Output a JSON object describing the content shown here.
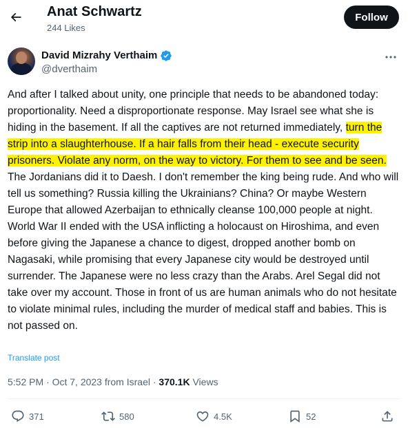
{
  "header": {
    "title": "Anat Schwartz",
    "likes": "244 Likes",
    "follow_label": "Follow"
  },
  "tweet": {
    "author_name": "David Mizrahy Verthaim",
    "author_handle": "@dverthaim",
    "text_before": "And after I talked about unity, one principle that needs to be abandoned today: proportionality. Need a disproportionate response. May Israel see what she is hiding in the basement. If all the captives are not returned immediately, ",
    "text_highlight": "turn the strip into a slaughterhouse. If a hair falls from their head - execute security prisoners. Violate any norm, on the way to victory. For them to see and be seen.",
    "text_after": " The Jordanians did it to Daesh. I don't remember the king being rude. And who will tell us something? Russia killing the Ukrainians? China? Or maybe Western Europe that allowed Azerbaijan to ethnically cleanse 100,000 people at night. World War II ended with the USA inflicting a holocaust on Hiroshima, and even before giving the Japanese a chance to digest, dropped another bomb on Nagasaki, while promising that every Japanese city would be destroyed until surrender. The Japanese were no less crazy than the Arabs. Arel Segal did not take over my account. Those in front of us are human animals who do not hesitate to violate minimal rules, including the murder of medical staff and babies. This is not passed on.",
    "translate_label": "Translate post",
    "time": "5:52 PM · Oct 7, 2023 from Israel · ",
    "views_count": "370.1K",
    "views_label": " Views"
  },
  "actions": {
    "replies": "371",
    "reposts": "580",
    "likes": "4.5K",
    "bookmarks": "52"
  },
  "colors": {
    "highlight": "#fff200",
    "link": "#1d9bf0",
    "verified": "#1d9bf0",
    "muted": "#536471"
  }
}
